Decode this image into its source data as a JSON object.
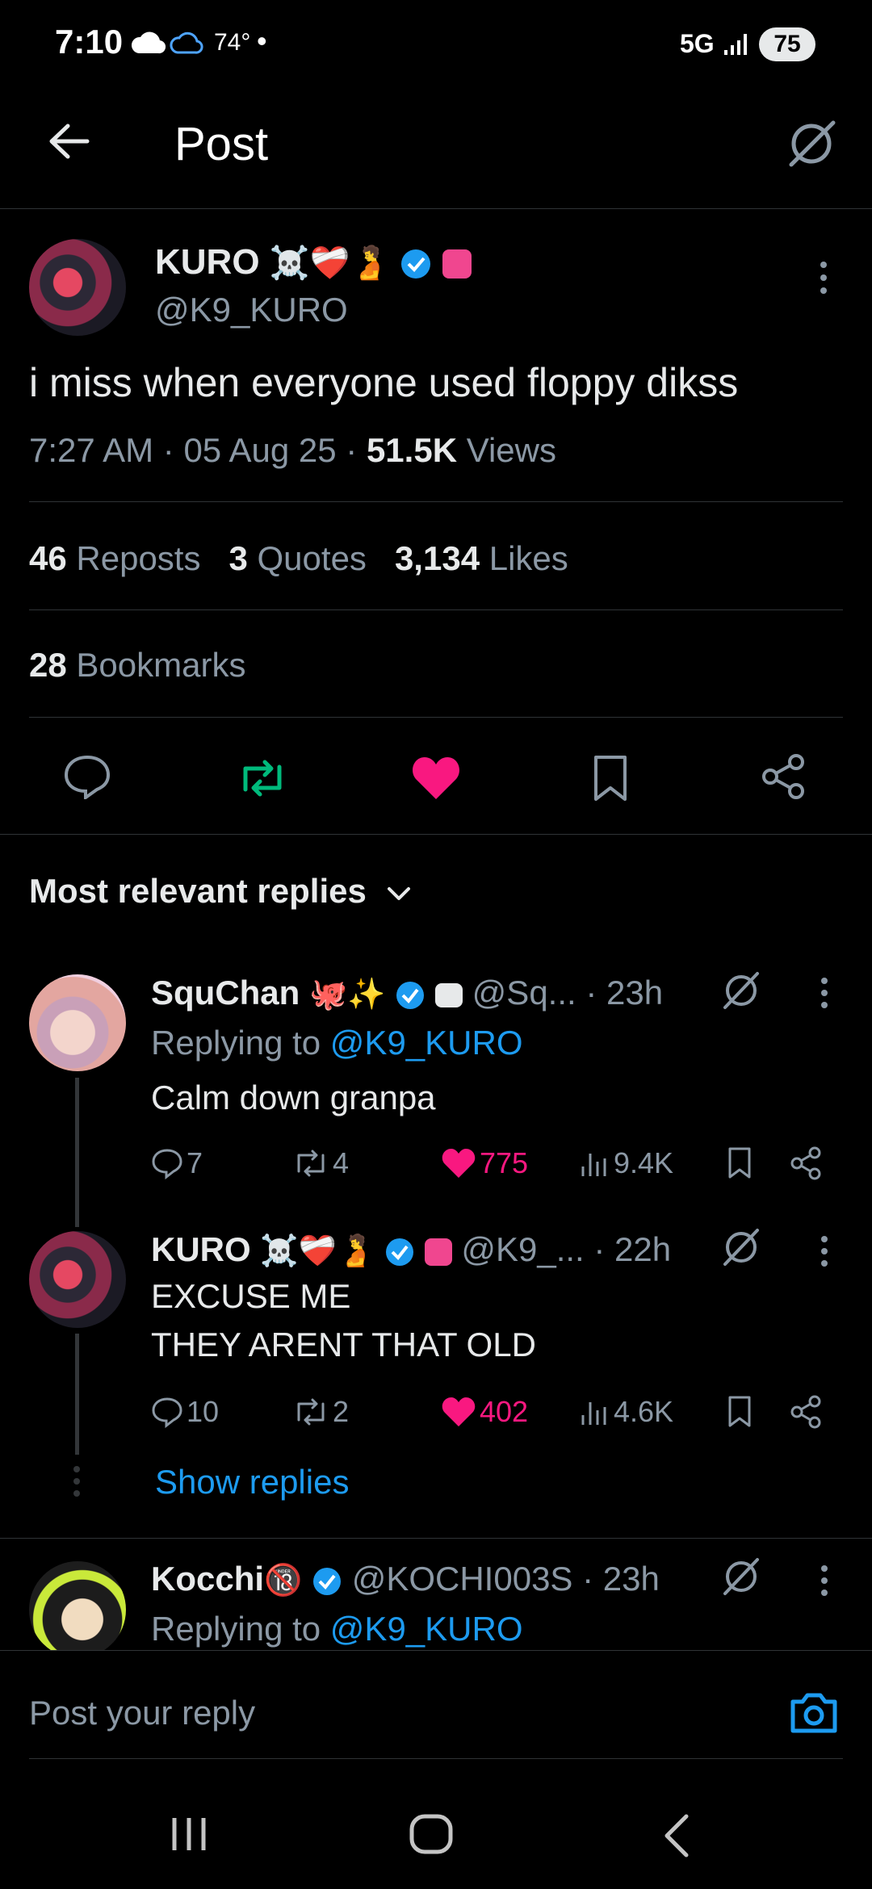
{
  "status_bar": {
    "time": "7:10",
    "temperature": "74°",
    "network": "5G",
    "battery": "75"
  },
  "header": {
    "title": "Post"
  },
  "post": {
    "author_name": "KURO",
    "author_handle": "@K9_KURO",
    "text": "i miss when everyone used floppy dikss",
    "time": "7:27 AM",
    "date": "05 Aug 25",
    "views_count": "51.5K",
    "views_label": "Views",
    "reposts_count": "46",
    "reposts_label": "Reposts",
    "quotes_count": "3",
    "quotes_label": "Quotes",
    "likes_count": "3,134",
    "likes_label": "Likes",
    "bookmarks_count": "28",
    "bookmarks_label": "Bookmarks"
  },
  "replies_section": {
    "sort_label": "Most relevant replies"
  },
  "replies": [
    {
      "name": "SquChan",
      "handle": "@Sq...",
      "time": "23h",
      "replying_prefix": "Replying to",
      "replying_handle": "@K9_KURO",
      "text": "Calm down granpa",
      "comments": "7",
      "reposts": "4",
      "likes": "775",
      "views": "9.4K"
    },
    {
      "name": "KURO",
      "handle": "@K9_...",
      "time": "22h",
      "text_line1": "EXCUSE ME",
      "text_line2": "THEY ARENT THAT OLD",
      "comments": "10",
      "reposts": "2",
      "likes": "402",
      "views": "4.6K",
      "show_replies": "Show replies"
    },
    {
      "name": "Kocchi",
      "handle": "@KOCHI003S",
      "time": "23h",
      "replying_prefix": "Replying to",
      "replying_handle": "@K9_KURO"
    }
  ],
  "reply_bar": {
    "placeholder": "Post your reply"
  },
  "colors": {
    "accent": "#1d9bf0",
    "like": "#f91880",
    "repost": "#00ba7c",
    "muted": "#8b98a5"
  }
}
